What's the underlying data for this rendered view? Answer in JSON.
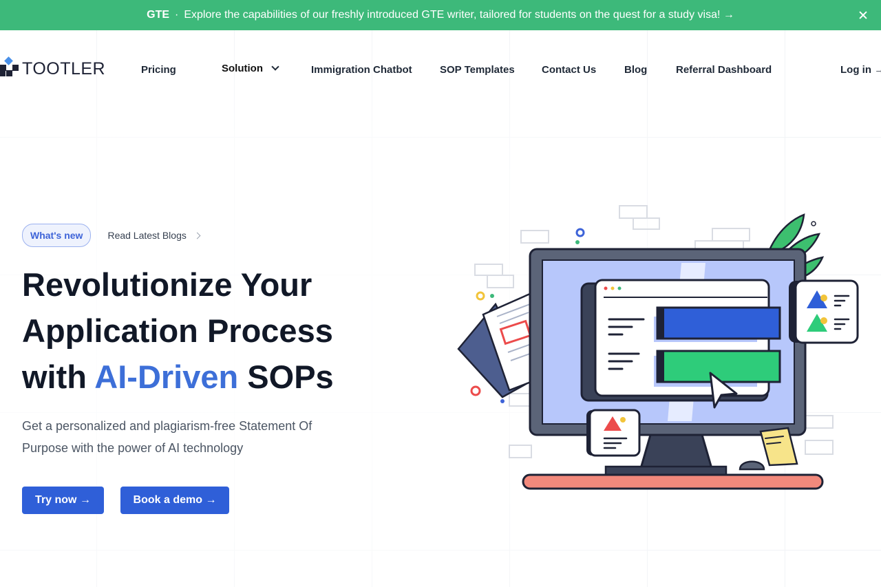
{
  "banner": {
    "tag": "GTE",
    "separator": "·",
    "message": "Explore the capabilities of our freshly introduced GTE writer, tailored for students on the quest for a study visa! →",
    "close_icon": "close-icon",
    "background": "#3db97a"
  },
  "nav": {
    "logo_text": "TOOTLER",
    "items": [
      {
        "label": "Pricing"
      },
      {
        "label": "Solution",
        "dropdown": true
      },
      {
        "label": "Immigration Chatbot"
      },
      {
        "label": "SOP Templates"
      },
      {
        "label": "Contact Us"
      },
      {
        "label": "Blog"
      },
      {
        "label": "Referral Dashboard"
      }
    ],
    "login": "Log in →"
  },
  "hero": {
    "badge": "What's new",
    "read_link": "Read Latest Blogs",
    "headline_line1": "Revolutionize Your",
    "headline_line2": "Application Process",
    "headline_line3_pre": "with ",
    "headline_line3_accent": "AI-Driven",
    "headline_line3_post": " SOPs",
    "subtitle": "Get a personalized and plagiarism-free Statement Of Purpose with the power of AI technology",
    "cta_primary": "Try now →",
    "cta_secondary": "Book a demo →"
  },
  "colors": {
    "accent": "#3d6fd8",
    "button": "#2f5fd8",
    "brand_dark": "#1e2235"
  }
}
